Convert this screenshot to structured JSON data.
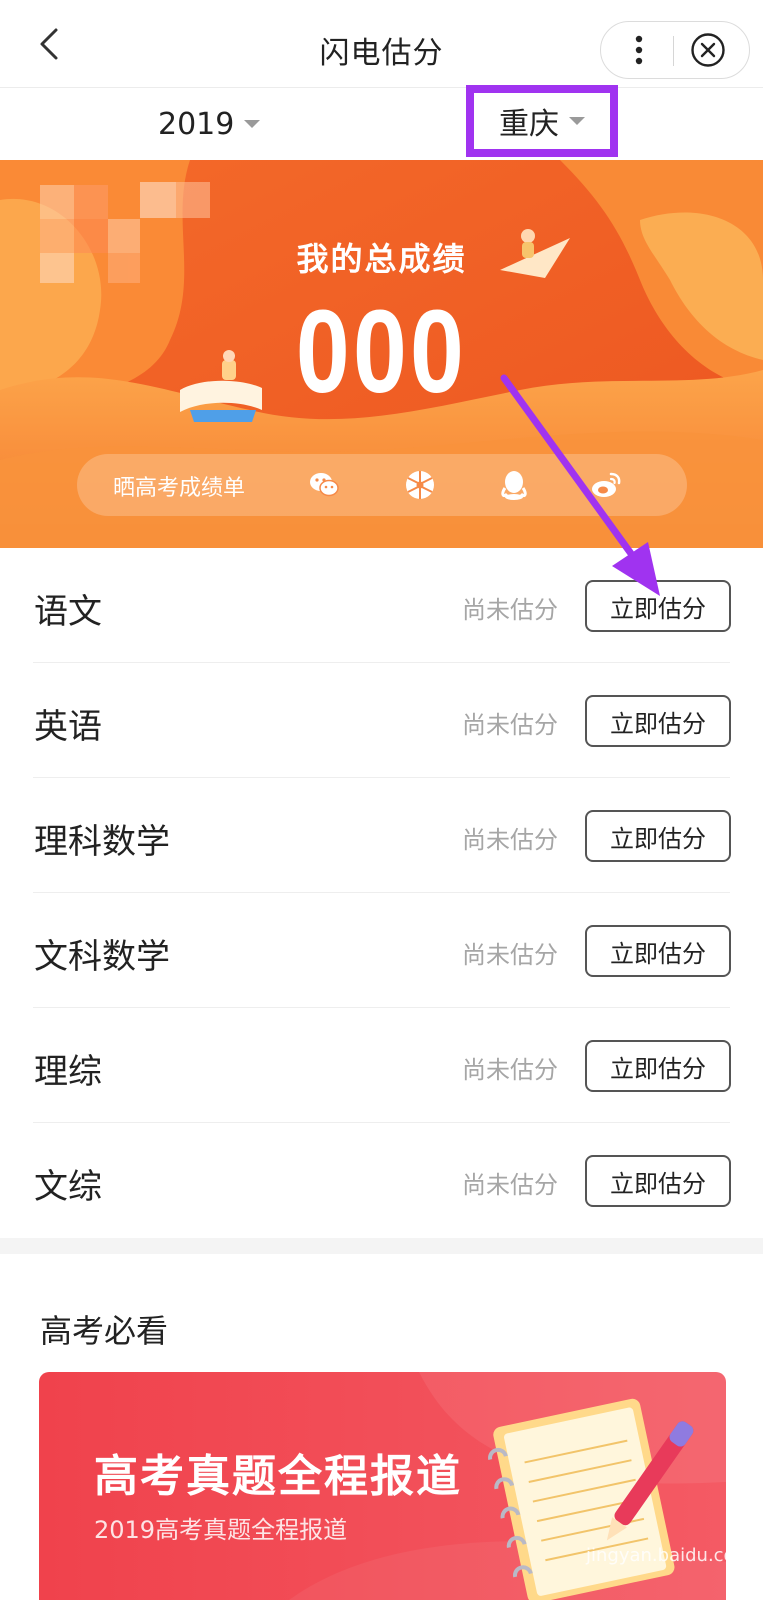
{
  "header": {
    "title": "闪电估分"
  },
  "filters": {
    "year": "2019",
    "province": "重庆"
  },
  "banner": {
    "title": "我的总成绩",
    "score": "000",
    "share_label": "晒高考成绩单",
    "share_icons": [
      "wechat-icon",
      "moments-icon",
      "qq-icon",
      "weibo-icon"
    ],
    "colors": {
      "primary": "#f2692a",
      "light": "#fb9a3c",
      "deep": "#e5431f"
    }
  },
  "subjects": [
    {
      "name": "语文",
      "status": "尚未估分",
      "button": "立即估分"
    },
    {
      "name": "英语",
      "status": "尚未估分",
      "button": "立即估分"
    },
    {
      "name": "理科数学",
      "status": "尚未估分",
      "button": "立即估分"
    },
    {
      "name": "文科数学",
      "status": "尚未估分",
      "button": "立即估分"
    },
    {
      "name": "理综",
      "status": "尚未估分",
      "button": "立即估分"
    },
    {
      "name": "文综",
      "status": "尚未估分",
      "button": "立即估分"
    }
  ],
  "must_see": {
    "title": "高考必看",
    "promo_title": "高考真题全程报道",
    "promo_subtitle": "2019高考真题全程报道",
    "promo_color": "#ef3d4a"
  },
  "watermark": "jingyan.baidu.com",
  "annotation": {
    "color": "#a033f0"
  }
}
